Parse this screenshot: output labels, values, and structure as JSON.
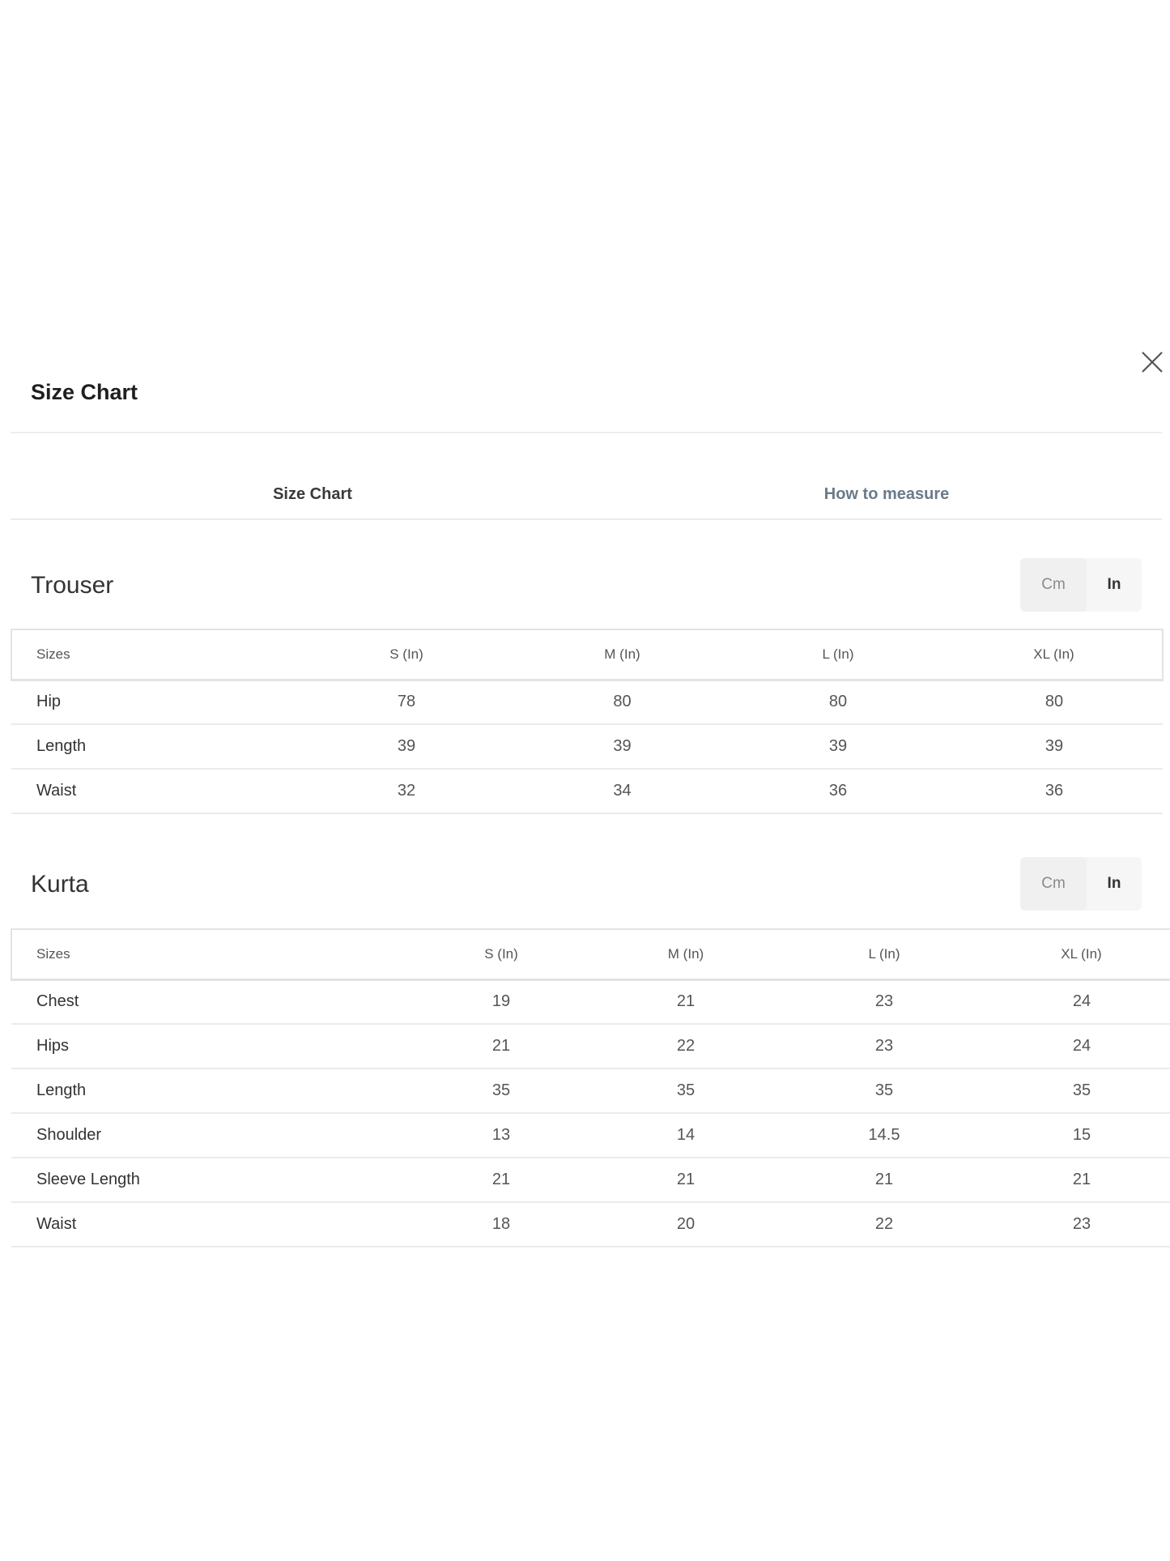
{
  "modal": {
    "title": "Size Chart"
  },
  "tabs": [
    {
      "label": "Size Chart",
      "active": true
    },
    {
      "label": "How to measure",
      "active": false
    }
  ],
  "unit_toggle": {
    "cm_label": "Cm",
    "in_label": "In",
    "selected": "In"
  },
  "sections": [
    {
      "title": "Trouser",
      "columns": [
        "Sizes",
        "S (In)",
        "M (In)",
        "L (In)",
        "XL (In)"
      ],
      "rows": [
        [
          "Hip",
          "78",
          "80",
          "80",
          "80"
        ],
        [
          "Length",
          "39",
          "39",
          "39",
          "39"
        ],
        [
          "Waist",
          "32",
          "34",
          "36",
          "36"
        ]
      ]
    },
    {
      "title": "Kurta",
      "columns": [
        "Sizes",
        "S (In)",
        "M (In)",
        "L (In)",
        "XL (In)"
      ],
      "rows": [
        [
          "Chest",
          "19",
          "21",
          "23",
          "24"
        ],
        [
          "Hips",
          "21",
          "22",
          "23",
          "24"
        ],
        [
          "Length",
          "35",
          "35",
          "35",
          "35"
        ],
        [
          "Shoulder",
          "13",
          "14",
          "14.5",
          "15"
        ],
        [
          "Sleeve Length",
          "21",
          "21",
          "21",
          "21"
        ],
        [
          "Waist",
          "18",
          "20",
          "22",
          "23"
        ]
      ]
    }
  ],
  "icons": {
    "close": "close-icon"
  },
  "colors": {
    "divider": "#ececec",
    "toggle_bg": "#f6f6f6",
    "inactive_tab": "#6b7a89"
  }
}
